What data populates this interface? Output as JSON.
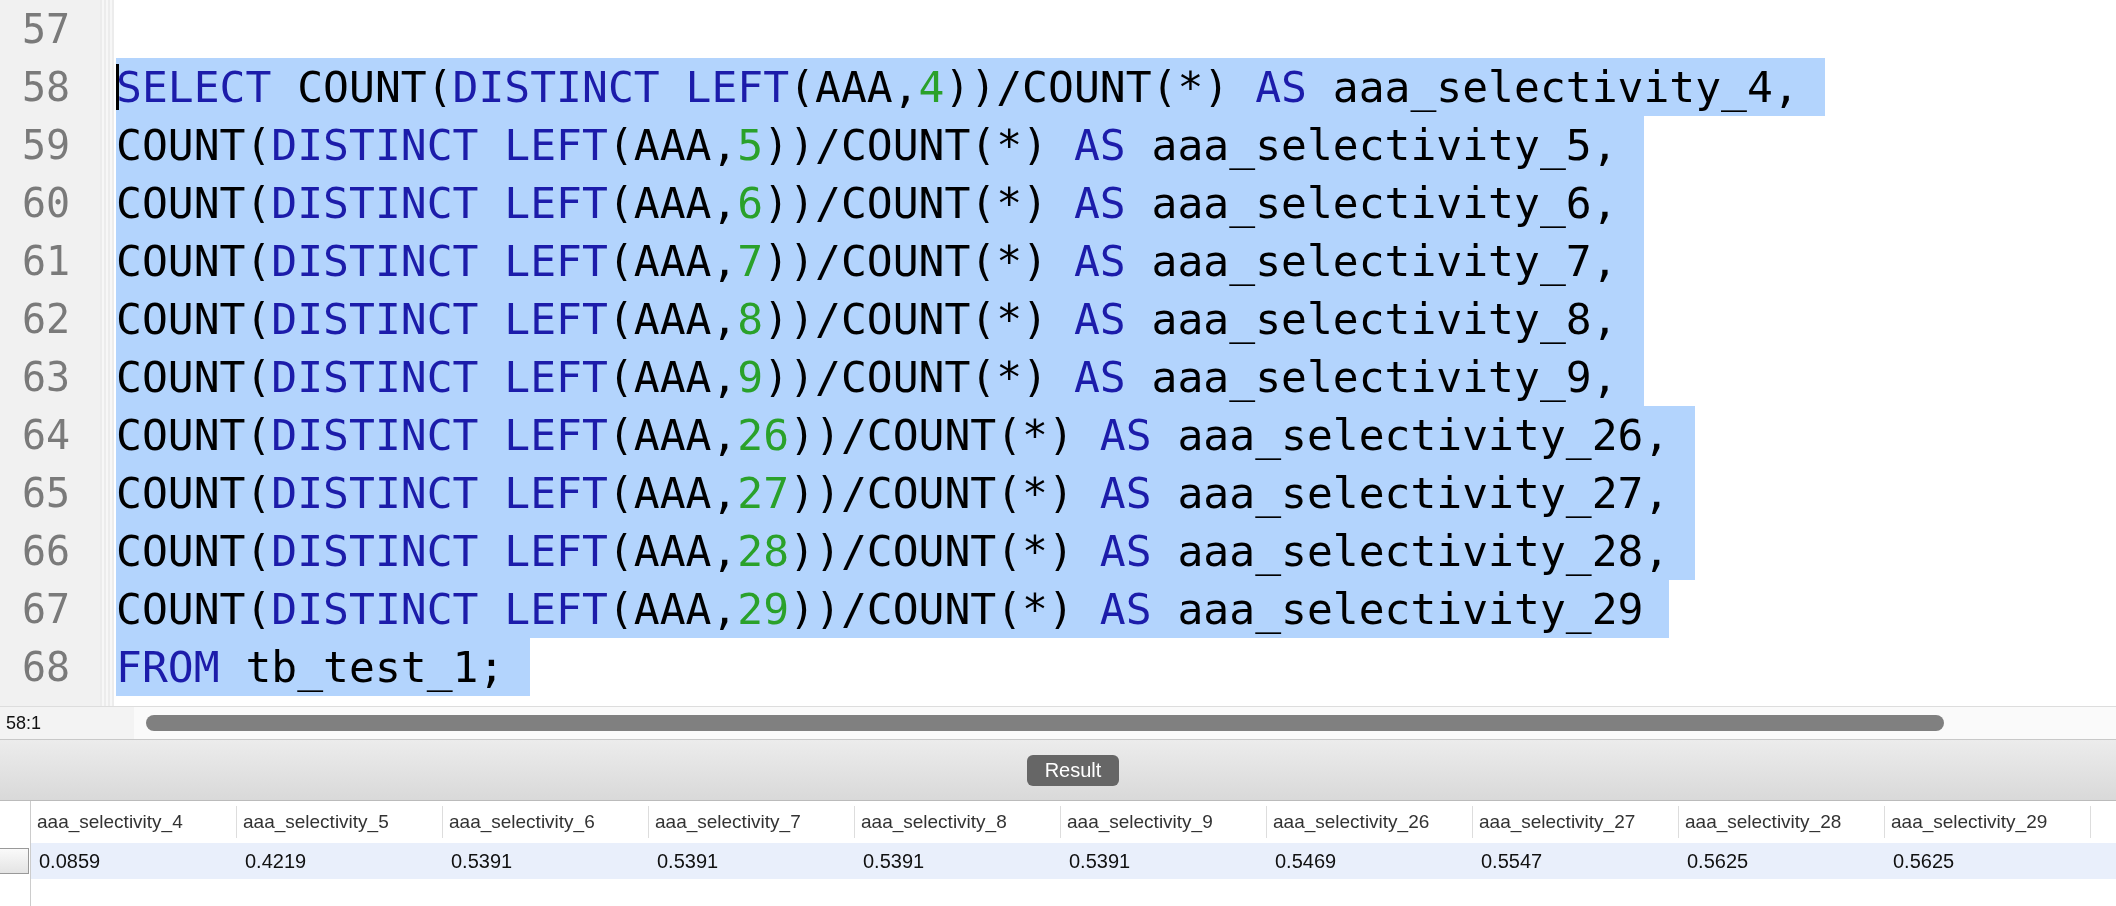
{
  "editor": {
    "lines": [
      {
        "number": "57",
        "selected": false,
        "caret": false
      },
      {
        "number": "58",
        "selected": true,
        "caret": true,
        "tokens": [
          {
            "kind": "keyword",
            "text": "SELECT"
          },
          {
            "kind": "plain",
            "text": " COUNT("
          },
          {
            "kind": "keyword",
            "text": "DISTINCT LEFT"
          },
          {
            "kind": "plain",
            "text": "(AAA,"
          },
          {
            "kind": "number",
            "text": "4"
          },
          {
            "kind": "plain",
            "text": "))/COUNT(*) "
          },
          {
            "kind": "keyword",
            "text": "AS"
          },
          {
            "kind": "plain",
            "text": " aaa_selectivity_4,"
          }
        ]
      },
      {
        "number": "59",
        "selected": true,
        "caret": false,
        "tokens": [
          {
            "kind": "plain",
            "text": "COUNT("
          },
          {
            "kind": "keyword",
            "text": "DISTINCT LEFT"
          },
          {
            "kind": "plain",
            "text": "(AAA,"
          },
          {
            "kind": "number",
            "text": "5"
          },
          {
            "kind": "plain",
            "text": "))/COUNT(*) "
          },
          {
            "kind": "keyword",
            "text": "AS"
          },
          {
            "kind": "plain",
            "text": " aaa_selectivity_5,"
          }
        ]
      },
      {
        "number": "60",
        "selected": true,
        "caret": false,
        "tokens": [
          {
            "kind": "plain",
            "text": "COUNT("
          },
          {
            "kind": "keyword",
            "text": "DISTINCT LEFT"
          },
          {
            "kind": "plain",
            "text": "(AAA,"
          },
          {
            "kind": "number",
            "text": "6"
          },
          {
            "kind": "plain",
            "text": "))/COUNT(*) "
          },
          {
            "kind": "keyword",
            "text": "AS"
          },
          {
            "kind": "plain",
            "text": " aaa_selectivity_6,"
          }
        ]
      },
      {
        "number": "61",
        "selected": true,
        "caret": false,
        "tokens": [
          {
            "kind": "plain",
            "text": "COUNT("
          },
          {
            "kind": "keyword",
            "text": "DISTINCT LEFT"
          },
          {
            "kind": "plain",
            "text": "(AAA,"
          },
          {
            "kind": "number",
            "text": "7"
          },
          {
            "kind": "plain",
            "text": "))/COUNT(*) "
          },
          {
            "kind": "keyword",
            "text": "AS"
          },
          {
            "kind": "plain",
            "text": " aaa_selectivity_7,"
          }
        ]
      },
      {
        "number": "62",
        "selected": true,
        "caret": false,
        "tokens": [
          {
            "kind": "plain",
            "text": "COUNT("
          },
          {
            "kind": "keyword",
            "text": "DISTINCT LEFT"
          },
          {
            "kind": "plain",
            "text": "(AAA,"
          },
          {
            "kind": "number",
            "text": "8"
          },
          {
            "kind": "plain",
            "text": "))/COUNT(*) "
          },
          {
            "kind": "keyword",
            "text": "AS"
          },
          {
            "kind": "plain",
            "text": " aaa_selectivity_8,"
          }
        ]
      },
      {
        "number": "63",
        "selected": true,
        "caret": false,
        "tokens": [
          {
            "kind": "plain",
            "text": "COUNT("
          },
          {
            "kind": "keyword",
            "text": "DISTINCT LEFT"
          },
          {
            "kind": "plain",
            "text": "(AAA,"
          },
          {
            "kind": "number",
            "text": "9"
          },
          {
            "kind": "plain",
            "text": "))/COUNT(*) "
          },
          {
            "kind": "keyword",
            "text": "AS"
          },
          {
            "kind": "plain",
            "text": " aaa_selectivity_9,"
          }
        ]
      },
      {
        "number": "64",
        "selected": true,
        "caret": false,
        "tokens": [
          {
            "kind": "plain",
            "text": "COUNT("
          },
          {
            "kind": "keyword",
            "text": "DISTINCT LEFT"
          },
          {
            "kind": "plain",
            "text": "(AAA,"
          },
          {
            "kind": "number",
            "text": "26"
          },
          {
            "kind": "plain",
            "text": "))/COUNT(*) "
          },
          {
            "kind": "keyword",
            "text": "AS"
          },
          {
            "kind": "plain",
            "text": " aaa_selectivity_26,"
          }
        ]
      },
      {
        "number": "65",
        "selected": true,
        "caret": false,
        "tokens": [
          {
            "kind": "plain",
            "text": "COUNT("
          },
          {
            "kind": "keyword",
            "text": "DISTINCT LEFT"
          },
          {
            "kind": "plain",
            "text": "(AAA,"
          },
          {
            "kind": "number",
            "text": "27"
          },
          {
            "kind": "plain",
            "text": "))/COUNT(*) "
          },
          {
            "kind": "keyword",
            "text": "AS"
          },
          {
            "kind": "plain",
            "text": " aaa_selectivity_27,"
          }
        ]
      },
      {
        "number": "66",
        "selected": true,
        "caret": false,
        "tokens": [
          {
            "kind": "plain",
            "text": "COUNT("
          },
          {
            "kind": "keyword",
            "text": "DISTINCT LEFT"
          },
          {
            "kind": "plain",
            "text": "(AAA,"
          },
          {
            "kind": "number",
            "text": "28"
          },
          {
            "kind": "plain",
            "text": "))/COUNT(*) "
          },
          {
            "kind": "keyword",
            "text": "AS"
          },
          {
            "kind": "plain",
            "text": " aaa_selectivity_28,"
          }
        ]
      },
      {
        "number": "67",
        "selected": true,
        "caret": false,
        "tokens": [
          {
            "kind": "plain",
            "text": "COUNT("
          },
          {
            "kind": "keyword",
            "text": "DISTINCT LEFT"
          },
          {
            "kind": "plain",
            "text": "(AAA,"
          },
          {
            "kind": "number",
            "text": "29"
          },
          {
            "kind": "plain",
            "text": "))/COUNT(*) "
          },
          {
            "kind": "keyword",
            "text": "AS"
          },
          {
            "kind": "plain",
            "text": " aaa_selectivity_29"
          }
        ]
      },
      {
        "number": "68",
        "selected": true,
        "caret": false,
        "tokens": [
          {
            "kind": "keyword",
            "text": "FROM"
          },
          {
            "kind": "plain",
            "text": " tb_test_1;"
          }
        ]
      }
    ]
  },
  "status_bar": {
    "position": "58:1"
  },
  "result_tab": {
    "label": "Result"
  },
  "table": {
    "columns": [
      "aaa_selectivity_4",
      "aaa_selectivity_5",
      "aaa_selectivity_6",
      "aaa_selectivity_7",
      "aaa_selectivity_8",
      "aaa_selectivity_9",
      "aaa_selectivity_26",
      "aaa_selectivity_27",
      "aaa_selectivity_28",
      "aaa_selectivity_29"
    ],
    "rows": [
      [
        "0.0859",
        "0.4219",
        "0.5391",
        "0.5391",
        "0.5391",
        "0.5391",
        "0.5469",
        "0.5547",
        "0.5625",
        "0.5625"
      ]
    ]
  }
}
